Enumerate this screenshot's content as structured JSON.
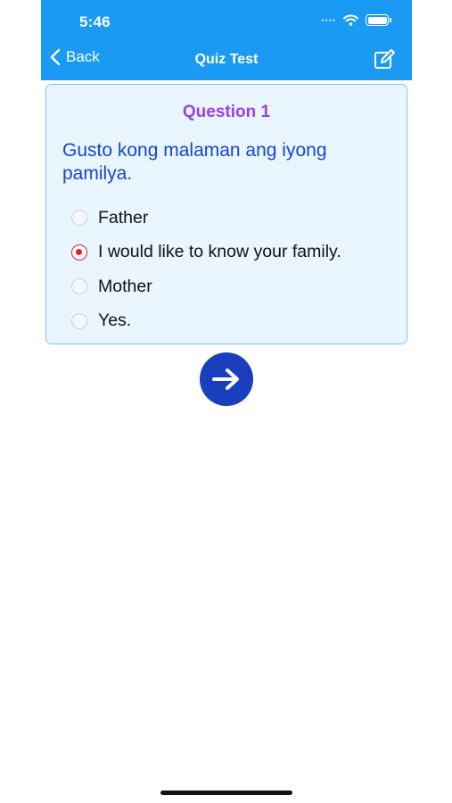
{
  "status": {
    "time": "5:46"
  },
  "nav": {
    "back_label": "Back",
    "title": "Quiz Test"
  },
  "question": {
    "number_label": "Question 1",
    "text": "Gusto kong malaman ang iyong pamilya.",
    "options": [
      {
        "label": "Father",
        "selected": false
      },
      {
        "label": "I would like to know your family.",
        "selected": true
      },
      {
        "label": "Mother",
        "selected": false
      },
      {
        "label": "Yes.",
        "selected": false
      }
    ]
  },
  "icons": {
    "back": "chevron-left-icon",
    "edit": "edit-icon",
    "next": "arrow-right-icon",
    "wifi": "wifi-icon",
    "battery": "battery-icon"
  },
  "colors": {
    "nav_bar": "#1a9af2",
    "question_number": "#9a3ff0",
    "question_text": "#1644d6",
    "selected_radio": "#e0212a",
    "next_button": "#1a3fbe",
    "card_bg": "#eaf6ff"
  }
}
